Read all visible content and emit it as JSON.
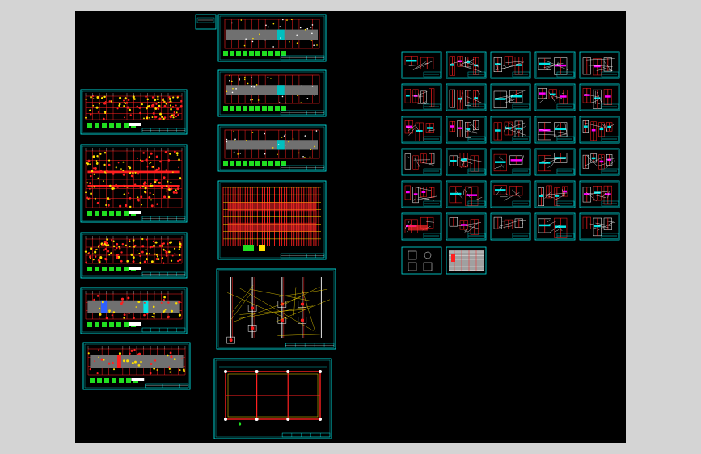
{
  "viewport": {
    "background": "#000000",
    "surround": "#d4d4d4"
  },
  "colors": {
    "frame": "#00e5e5",
    "red": "#ff2020",
    "yellow": "#ffe000",
    "green": "#20e020",
    "white": "#ffffff",
    "magenta": "#ff00ff",
    "blue": "#3060ff",
    "gray": "#707070"
  },
  "sheet_groups": {
    "left_column": "plan-sheets",
    "middle_column": "detail-sheets",
    "right_grid": "section-sheets"
  }
}
